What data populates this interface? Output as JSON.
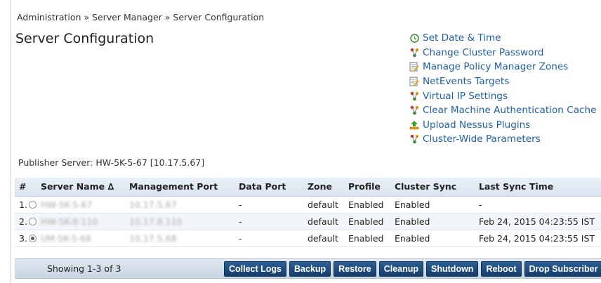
{
  "breadcrumb": "Administration » Server Manager » Server Configuration",
  "title": "Server Configuration",
  "links": [
    {
      "label": "Set Date & Time",
      "icon": "clock-icon"
    },
    {
      "label": "Change Cluster Password",
      "icon": "cluster-icon"
    },
    {
      "label": "Manage Policy Manager Zones",
      "icon": "edit-doc-icon"
    },
    {
      "label": "NetEvents Targets",
      "icon": "edit-doc-icon"
    },
    {
      "label": "Virtual IP Settings",
      "icon": "cluster-icon"
    },
    {
      "label": "Clear Machine Authentication Cache",
      "icon": "cluster-icon"
    },
    {
      "label": "Upload Nessus Plugins",
      "icon": "upload-icon"
    },
    {
      "label": "Cluster-Wide Parameters",
      "icon": "cluster-icon"
    }
  ],
  "publisher": "Publisher Server: HW-5K-5-67 [10.17.5.67]",
  "table": {
    "headers": [
      "#",
      "Server Name ∆",
      "Management Port",
      "Data Port",
      "Zone",
      "Profile",
      "Cluster Sync",
      "Last Sync Time"
    ],
    "rows": [
      {
        "num": "1.",
        "selected": false,
        "name": "HW-5K-5-67",
        "mgmt": "10.17.5.67",
        "data_port": "-",
        "zone": "default",
        "profile": "Enabled",
        "sync": "Enabled",
        "last": "-"
      },
      {
        "num": "2.",
        "selected": false,
        "name": "HW-5K-8-110",
        "mgmt": "10.17.8.110",
        "data_port": "-",
        "zone": "default",
        "profile": "Enabled",
        "sync": "Enabled",
        "last": "Feb 24, 2015 04:23:55 IST"
      },
      {
        "num": "3.",
        "selected": true,
        "name": "UM-5K-5-68",
        "mgmt": "10.17.5.68",
        "data_port": "-",
        "zone": "default",
        "profile": "Enabled",
        "sync": "Enabled",
        "last": "Feb 24, 2015 04:23:55 IST"
      }
    ]
  },
  "footer": {
    "showing": "Showing 1-3 of 3",
    "buttons": [
      "Collect Logs",
      "Backup",
      "Restore",
      "Cleanup",
      "Shutdown",
      "Reboot",
      "Drop Subscriber"
    ]
  },
  "colors": {
    "link": "#1f5fa8",
    "button": "#1f4f80",
    "header": "#dfe8f1"
  }
}
